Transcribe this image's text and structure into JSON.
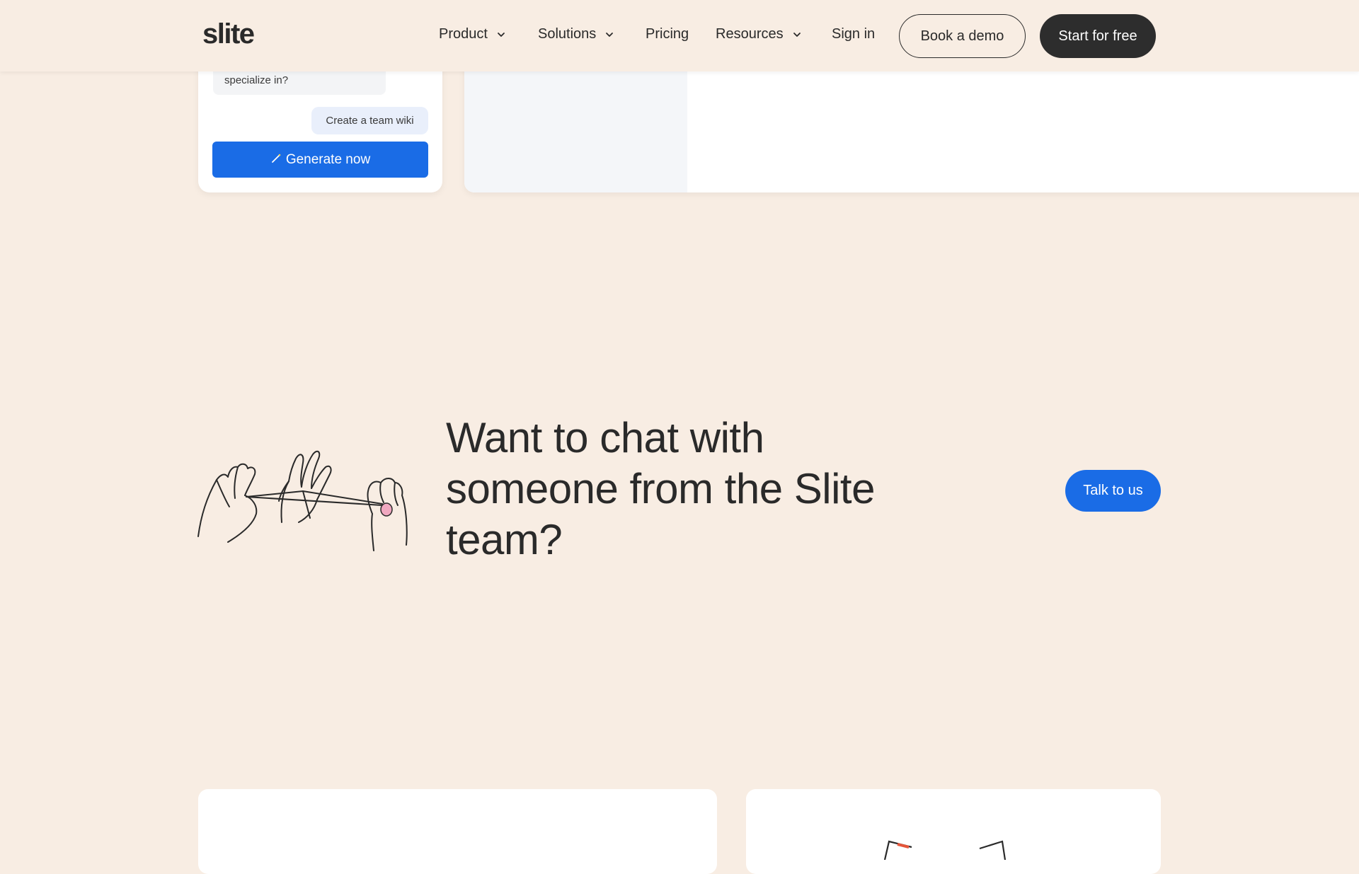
{
  "nav": {
    "logo": "slite",
    "items": [
      {
        "label": "Product",
        "has_dropdown": true
      },
      {
        "label": "Solutions",
        "has_dropdown": true
      },
      {
        "label": "Pricing",
        "has_dropdown": false
      },
      {
        "label": "Resources",
        "has_dropdown": true
      }
    ],
    "sign_in": "Sign in",
    "book_demo": "Book a demo",
    "start_free": "Start for free"
  },
  "chat_widget": {
    "bot_message": "specialize in?",
    "user_message": "Create a team wiki",
    "generate_label": "Generate now"
  },
  "cta": {
    "title": "Want to chat with someone from the Slite team?",
    "button": "Talk to us"
  },
  "colors": {
    "background": "#f8ede3",
    "primary_blue": "#1a6ce6",
    "dark": "#2d2d2d"
  }
}
